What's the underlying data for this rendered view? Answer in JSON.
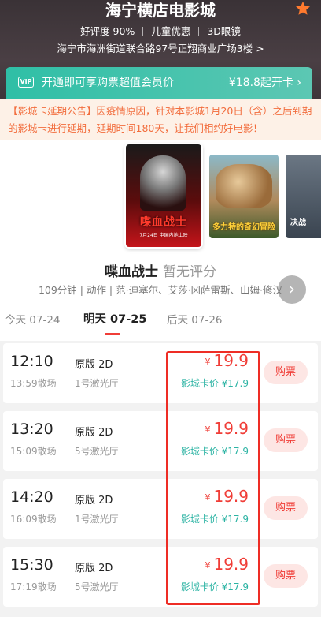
{
  "header": {
    "title": "海宁横店电影城",
    "tags": [
      "好评度 90%",
      "儿童优惠",
      "3D眼镜"
    ],
    "address": "海宁市海洲街道联合路97号正翔商业广场3楼",
    "address_chevron": ">",
    "favorite_icon": "star-icon",
    "favorite_color": "#ff7a2e"
  },
  "vip": {
    "badge": "VIP",
    "text": "开通即可享购票超值会员价",
    "price": "¥18.8起开卡 ›"
  },
  "notice": {
    "text": "【影城卡延期公告】因疫情原因，针对本影城1月20日（含）之后到期的影城卡进行延期，延期时间180天，让我们相约好电影！"
  },
  "movie": {
    "posters": [
      {
        "title": "喋血战士",
        "date": "7月24日 中国内地上映"
      },
      {
        "title": "多力特的奇幻冒险"
      },
      {
        "title": "决战"
      }
    ],
    "name": "喋血战士",
    "rating": "暂无评分",
    "info": "109分钟 | 动作 | 范·迪塞尔、艾莎·冈萨雷斯、山姆·修汉",
    "next_icon": "chevron-right-icon"
  },
  "dates": [
    {
      "label": "今天 07-24"
    },
    {
      "label": "明天 07-25"
    },
    {
      "label": "后天 07-26"
    }
  ],
  "showtimes": [
    {
      "start": "12:10",
      "end": "13:59散场",
      "version": "原版 2D",
      "hall": "1号激光厅",
      "currency": "¥",
      "price": "19.9",
      "card_price": "影城卡价 ¥17.9",
      "buy": "购票"
    },
    {
      "start": "13:20",
      "end": "15:09散场",
      "version": "原版 2D",
      "hall": "5号激光厅",
      "currency": "¥",
      "price": "19.9",
      "card_price": "影城卡价 ¥17.9",
      "buy": "购票"
    },
    {
      "start": "14:20",
      "end": "16:09散场",
      "version": "原版 2D",
      "hall": "1号激光厅",
      "currency": "¥",
      "price": "19.9",
      "card_price": "影城卡价 ¥17.9",
      "buy": "购票"
    },
    {
      "start": "15:30",
      "end": "17:19散场",
      "version": "原版 2D",
      "hall": "5号激光厅",
      "currency": "¥",
      "price": "19.9",
      "card_price": "影城卡价 ¥17.9",
      "buy": "购票"
    }
  ],
  "colors": {
    "accent_red": "#f03d37",
    "vip_teal": "#2fbfa6",
    "card_price_teal": "#2bb3a3",
    "notice_orange": "#f26d3d"
  }
}
